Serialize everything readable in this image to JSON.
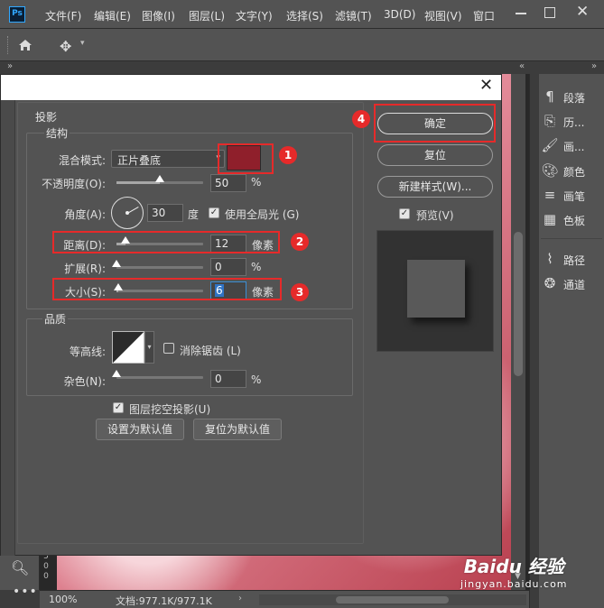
{
  "app": {
    "logo": "Ps",
    "menu": [
      "文件(F)",
      "编辑(E)",
      "图像(I)",
      "图层(L)",
      "文字(Y)",
      "选择(S)",
      "滤镜(T)",
      "3D(D)",
      "视图(V)",
      "窗口"
    ]
  },
  "canvas": {
    "ruler_digits": [
      "5",
      "0",
      "0"
    ],
    "zoom": "100%",
    "doc_info": "文档:977.1K/977.1K"
  },
  "panel": {
    "items": [
      {
        "icon": "paragraph-icon",
        "label": "段落"
      },
      {
        "icon": "history-icon",
        "label": "历..."
      },
      {
        "icon": "brush-icon",
        "label": "画..."
      },
      {
        "icon": "palette-icon",
        "label": "颜色"
      },
      {
        "icon": "brush-settings-icon",
        "label": "画笔"
      },
      {
        "icon": "swatches-icon",
        "label": "色板"
      },
      {
        "icon": "paths-icon",
        "label": "路径"
      },
      {
        "icon": "channels-icon",
        "label": "通道"
      }
    ]
  },
  "dialog": {
    "section_title": "投影",
    "structure": {
      "title": "结构",
      "blend_mode_label": "混合模式:",
      "blend_mode_value": "正片叠底",
      "shadow_color": "#8f1f2b",
      "opacity_label": "不透明度(O):",
      "opacity_value": "50",
      "opacity_unit": "%",
      "angle_label": "角度(A):",
      "angle_value": "30",
      "angle_unit": "度",
      "global_light_label": "使用全局光 (G)",
      "global_light_checked": true,
      "distance_label": "距离(D):",
      "distance_value": "12",
      "distance_unit": "像素",
      "spread_label": "扩展(R):",
      "spread_value": "0",
      "spread_unit": "%",
      "size_label": "大小(S):",
      "size_value": "6",
      "size_unit": "像素"
    },
    "quality": {
      "title": "品质",
      "contour_label": "等高线:",
      "antialias_label": "消除锯齿 (L)",
      "antialias_checked": false,
      "noise_label": "杂色(N):",
      "noise_value": "0",
      "noise_unit": "%"
    },
    "knockout_label": "图层挖空投影(U)",
    "knockout_checked": true,
    "make_default": "设置为默认值",
    "reset_default": "复位为默认值",
    "ok_button": "确定",
    "reset_button": "复位",
    "new_style_button": "新建样式(W)...",
    "preview_label": "预览(V)",
    "preview_checked": true
  },
  "annotations": [
    "1",
    "2",
    "3",
    "4"
  ],
  "watermark": {
    "main": "Baidu 经验",
    "sub": "jingyan.baidu.com"
  }
}
